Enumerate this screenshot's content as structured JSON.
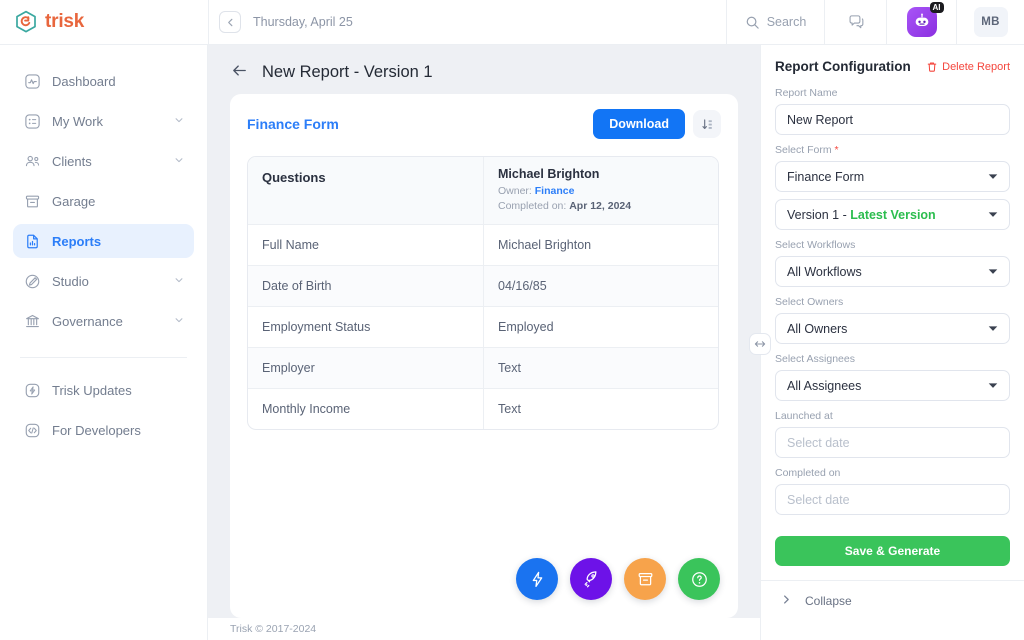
{
  "brand": {
    "name": "trisk"
  },
  "topbar": {
    "collapse_icon": "chevron-left-icon",
    "date": "Thursday, April 25",
    "search_label": "Search",
    "search_icon": "search-icon",
    "chat_icon": "chat-bubbles-icon",
    "ai_icon": "ai-robot-icon",
    "ai_badge": "AI",
    "avatar_initials": "MB"
  },
  "sidebar": {
    "items": [
      {
        "label": "Dashboard",
        "icon": "dashboard-pulse-icon",
        "expandable": false,
        "active": false
      },
      {
        "label": "My Work",
        "icon": "my-work-list-icon",
        "expandable": true,
        "active": false
      },
      {
        "label": "Clients",
        "icon": "clients-people-icon",
        "expandable": true,
        "active": false
      },
      {
        "label": "Garage",
        "icon": "garage-box-icon",
        "expandable": false,
        "active": false
      },
      {
        "label": "Reports",
        "icon": "reports-document-chart-icon",
        "expandable": false,
        "active": true
      },
      {
        "label": "Studio",
        "icon": "studio-pen-icon",
        "expandable": true,
        "active": false
      },
      {
        "label": "Governance",
        "icon": "governance-bank-icon",
        "expandable": true,
        "active": false
      }
    ],
    "secondary_items": [
      {
        "label": "Trisk Updates",
        "icon": "lightning-updates-icon"
      },
      {
        "label": "For Developers",
        "icon": "code-brackets-icon"
      }
    ]
  },
  "main": {
    "back_icon": "back-arrow-icon",
    "page_title": "New Report - Version 1",
    "card": {
      "title": "Finance Form",
      "download_label": "Download",
      "sort_icon": "sort-descending-icon",
      "table": {
        "question_header": "Questions",
        "respondent": {
          "name": "Michael Brighton",
          "owner_label": "Owner:",
          "owner_value": "Finance",
          "completed_label": "Completed on:",
          "completed_value": "Apr 12, 2024"
        },
        "rows": [
          {
            "question": "Full Name",
            "answer": "Michael Brighton"
          },
          {
            "question": "Date of Birth",
            "answer": "04/16/85"
          },
          {
            "question": "Employment Status",
            "answer": "Employed"
          },
          {
            "question": "Employer",
            "answer": "Text"
          },
          {
            "question": "Monthly Income",
            "answer": "Text"
          }
        ]
      }
    },
    "fabs": [
      {
        "icon": "lightning-bolt-icon",
        "color": "#1a73f0"
      },
      {
        "icon": "rocket-icon",
        "color": "#6d12e8"
      },
      {
        "icon": "archive-box-icon",
        "color": "#f7a34b"
      },
      {
        "icon": "help-question-icon",
        "color": "#3ac45b"
      }
    ],
    "resize_handle_icon": "horizontal-resize-icon"
  },
  "footer": {
    "text": "Trisk © 2017-2024"
  },
  "right_panel": {
    "title": "Report Configuration",
    "delete_label": "Delete Report",
    "delete_icon": "trash-icon",
    "fields": {
      "report_name": {
        "label": "Report Name",
        "value": "New Report"
      },
      "select_form": {
        "label": "Select Form",
        "required": "*",
        "value": "Finance Form"
      },
      "version": {
        "value_plain": "Version 1 - ",
        "value_green": "Latest Version"
      },
      "select_workflows": {
        "label": "Select Workflows",
        "value": "All Workflows"
      },
      "select_owners": {
        "label": "Select Owners",
        "value": "All Owners"
      },
      "select_assignees": {
        "label": "Select Assignees",
        "value": "All Assignees"
      },
      "launched_at": {
        "label": "Launched at",
        "placeholder": "Select date"
      },
      "completed_on": {
        "label": "Completed on",
        "placeholder": "Select date"
      }
    },
    "save_label": "Save & Generate",
    "collapse_label": "Collapse",
    "collapse_icon": "chevron-right-icon"
  },
  "colors": {
    "brand_orange": "#e8663d",
    "brand_teal": "#3aa8a0",
    "accent_blue": "#1275f5",
    "active_nav_bg": "#e8f1fe",
    "green": "#3ac45b",
    "danger_red": "#f4463d"
  }
}
